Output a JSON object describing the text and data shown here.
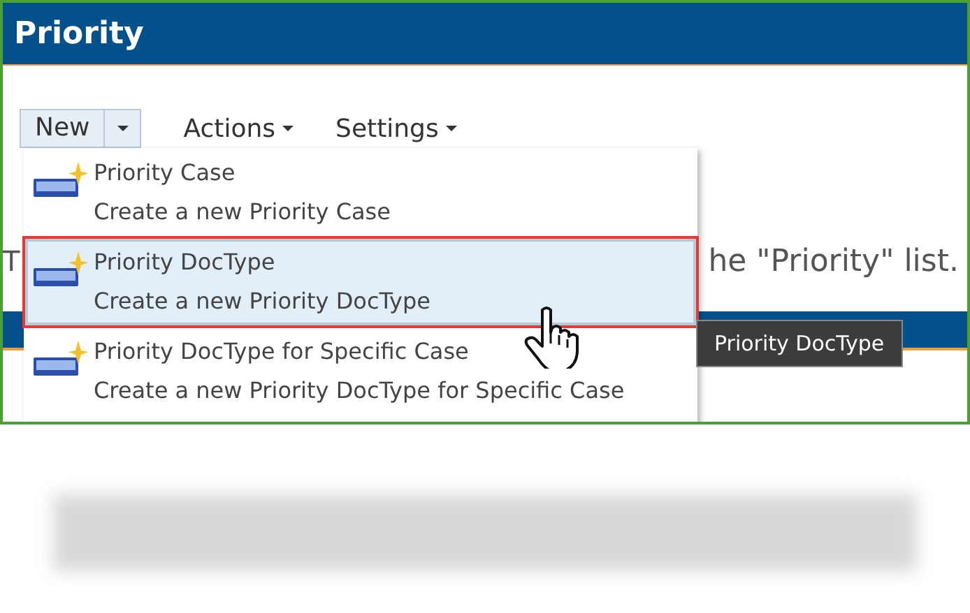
{
  "title": "Priority",
  "toolbar": [
    {
      "label": "New",
      "kind": "split"
    },
    {
      "label": "Actions",
      "kind": "dropdown"
    },
    {
      "label": "Settings",
      "kind": "dropdown"
    }
  ],
  "background_text": [
    "T",
    "he \"Priority\" list."
  ],
  "menu": {
    "items": [
      {
        "title": "Priority Case",
        "description": "Create a new Priority Case",
        "selected": false
      },
      {
        "title": "Priority DocType",
        "description": "Create a new Priority DocType",
        "selected": true
      },
      {
        "title": "Priority DocType for Specific Case",
        "description": "Create a new Priority DocType for Specific Case",
        "selected": false
      }
    ]
  },
  "tooltip": "Priority DocType"
}
